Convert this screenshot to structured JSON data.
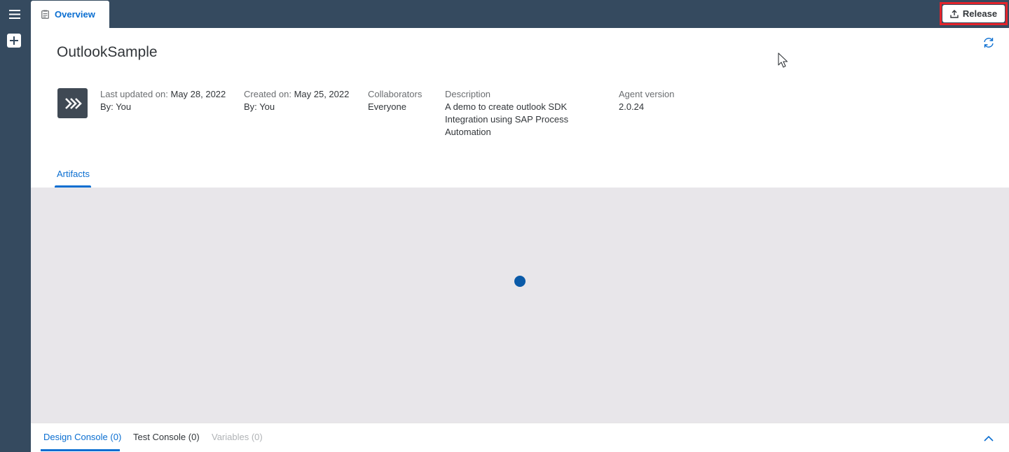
{
  "header": {
    "tabs": [
      {
        "label": "Overview",
        "icon": "document-icon"
      }
    ],
    "release_label": "Release",
    "release_icon": "upload-icon",
    "settings_icon": "gear-icon"
  },
  "sidebar": {
    "menu_icon": "hamburger-icon",
    "add_icon": "plus-icon"
  },
  "project": {
    "title": "OutlookSample",
    "avatar_icon": "double-chevron-right-icon",
    "last_updated_label": "Last updated on:",
    "last_updated_value": "May 28, 2022",
    "updated_by_label": "By:",
    "updated_by_value": "You",
    "created_label": "Created on:",
    "created_value": "May 25, 2022",
    "created_by_label": "By:",
    "created_by_value": "You",
    "collaborators_label": "Collaborators",
    "collaborators_value": "Everyone",
    "description_label": "Description",
    "description_value": "A demo to create outlook SDK Integration using SAP Process Automation",
    "agent_version_label": "Agent version",
    "agent_version_value": "2.0.24"
  },
  "content_tabs": [
    {
      "label": "Artifacts",
      "selected": true
    }
  ],
  "console": {
    "tabs": [
      {
        "label": "Design Console (0)",
        "selected": true
      },
      {
        "label": "Test Console (0)",
        "selected": false
      },
      {
        "label": "Variables (0)",
        "selected": false,
        "disabled": true
      }
    ]
  },
  "colors": {
    "shell": "#354a5f",
    "accent": "#0a6ed1",
    "highlight": "#e3242b",
    "content_bg": "#e8e6ea"
  }
}
